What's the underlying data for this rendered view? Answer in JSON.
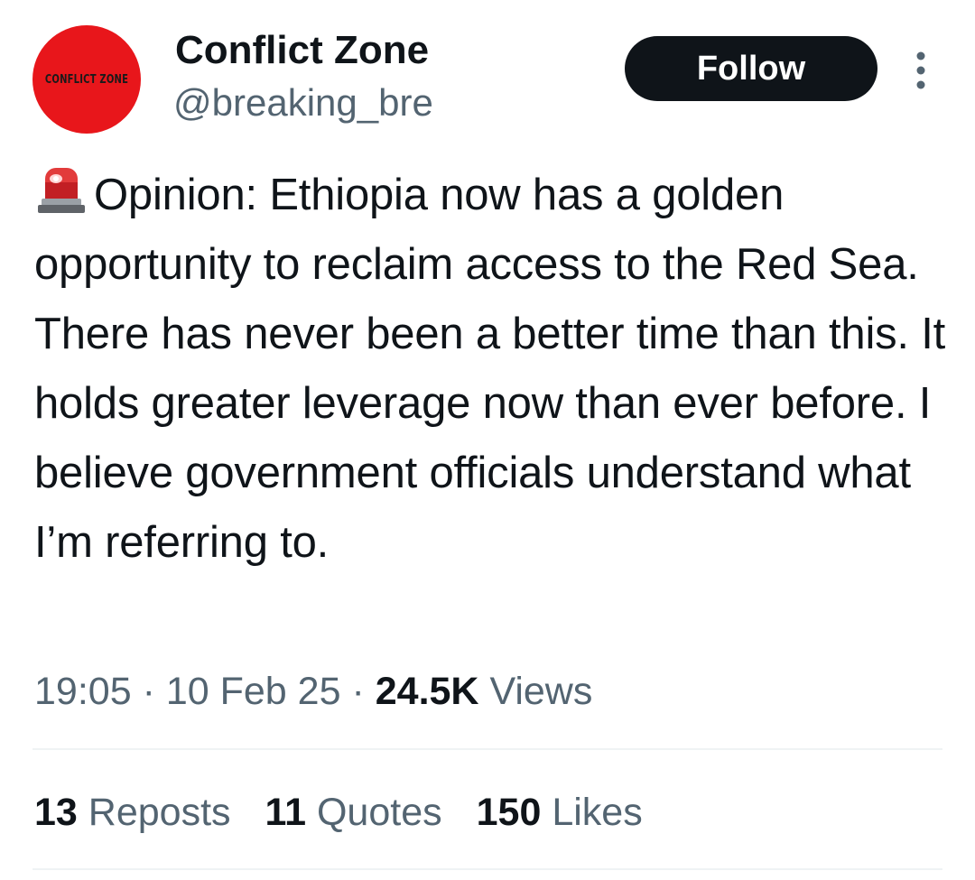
{
  "author": {
    "avatar_text": "CONFLICT ZONE",
    "avatar_color": "#e8161b",
    "display_name": "Conflict Zone",
    "handle": "@breaking_bre"
  },
  "follow_button": {
    "label": "Follow"
  },
  "more_icon": "more-vertical-icon",
  "tweet": {
    "emoji_icon": "police-siren-icon",
    "text": "Opinion: Ethiopia now has a golden opportunity to reclaim access to the Red Sea. There has never been a better time than this. It holds greater leverage now than ever before. I believe government officials understand what I’m referring to."
  },
  "meta": {
    "time": "19:05",
    "separator": "·",
    "date": "10 Feb 25",
    "views_count": "24.5K",
    "views_label": "Views"
  },
  "stats": [
    {
      "count": "13",
      "label": "Reposts"
    },
    {
      "count": "11",
      "label": "Quotes"
    },
    {
      "count": "150",
      "label": "Likes"
    }
  ],
  "colors": {
    "text_primary": "#0f1419",
    "text_secondary": "#536471",
    "divider": "#eff3f4",
    "follow_bg": "#0f1419"
  }
}
